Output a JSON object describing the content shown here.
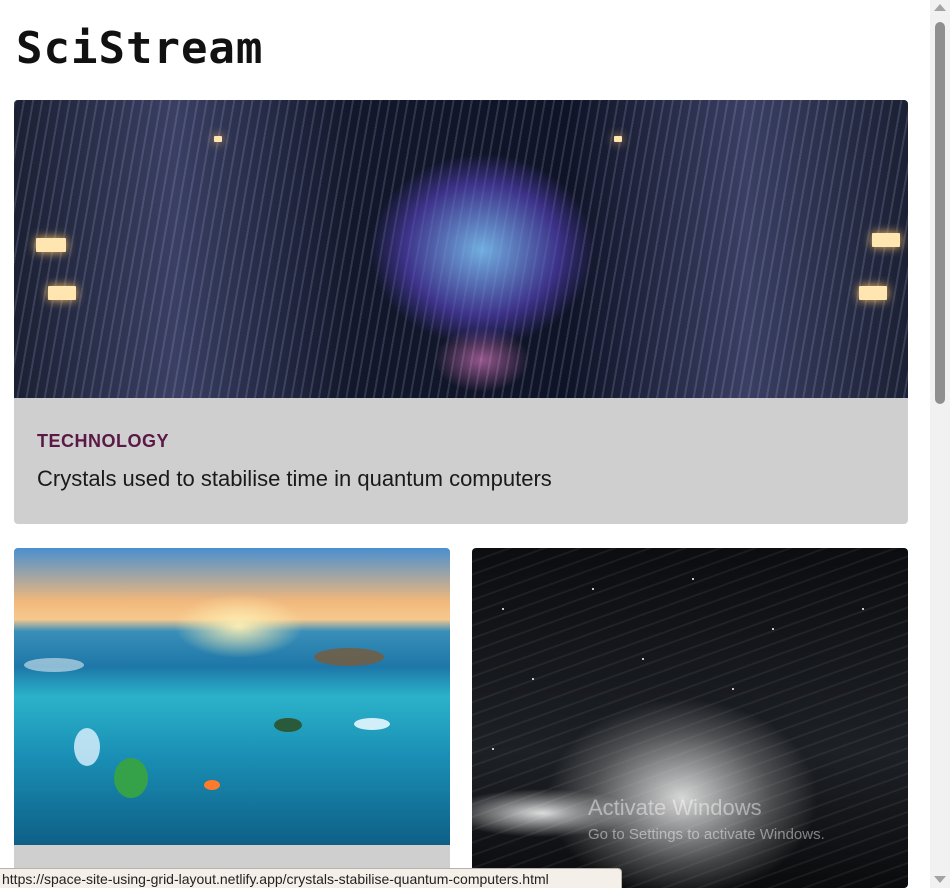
{
  "site": {
    "title": "SciStream"
  },
  "featured": {
    "category": "TECHNOLOGY",
    "headline": "Crystals used to stabilise time in quantum computers"
  },
  "status_bar": {
    "url": "https://space-site-using-grid-layout.netlify.app/crystals-stabilise-quantum-computers.html"
  },
  "watermark": {
    "title": "Activate Windows",
    "subtitle": "Go to Settings to activate Windows."
  },
  "colors": {
    "category_accent": "#5a1846",
    "card_background": "#cfcfcf"
  }
}
